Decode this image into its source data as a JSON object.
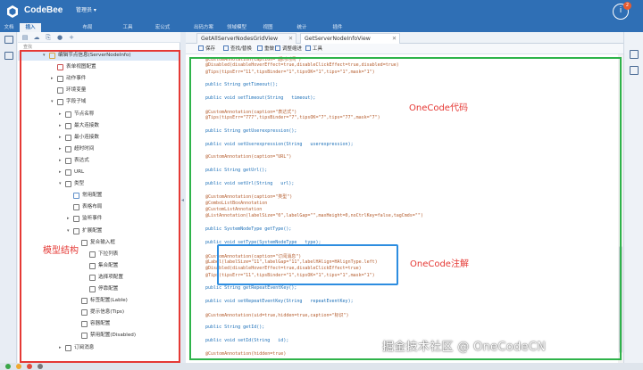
{
  "app": {
    "name": "CodeBee",
    "mode": "管理员 ▾",
    "notifications": "2"
  },
  "menu": [
    "文档",
    "插入",
    "布局",
    "工具",
    "宏公式",
    "出码方案",
    "领域模型",
    "视图",
    "统计",
    "插件"
  ],
  "menu_active": "插入",
  "tree_toolbar": [
    "▤",
    "☁",
    "⎘",
    "●",
    "+"
  ],
  "tree_header": "查找",
  "tree": [
    {
      "label": "编辑节点信息(ServerNodeInfo)",
      "depth": 0,
      "toggle": "▾",
      "color": "#d9a441"
    },
    {
      "label": "表单视图配置",
      "depth": 1,
      "toggle": "",
      "color": "#c94d4d"
    },
    {
      "label": "动作事件",
      "depth": 1,
      "toggle": "▸",
      "color": "#777"
    },
    {
      "label": "环境变量",
      "depth": 1,
      "toggle": "",
      "color": "#777"
    },
    {
      "label": "字段子域",
      "depth": 1,
      "toggle": "▾",
      "color": "#777"
    },
    {
      "label": "节点名称",
      "depth": 2,
      "toggle": "▸",
      "color": "#777"
    },
    {
      "label": "最大连接数",
      "depth": 2,
      "toggle": "▸",
      "color": "#777"
    },
    {
      "label": "最小连接数",
      "depth": 2,
      "toggle": "▸",
      "color": "#777"
    },
    {
      "label": "超时时间",
      "depth": 2,
      "toggle": "▸",
      "color": "#777"
    },
    {
      "label": "表达式",
      "depth": 2,
      "toggle": "▸",
      "color": "#777"
    },
    {
      "label": "URL",
      "depth": 2,
      "toggle": "▸",
      "color": "#777"
    },
    {
      "label": "类型",
      "depth": 2,
      "toggle": "▾",
      "color": "#777"
    },
    {
      "label": "常用配置",
      "depth": 3,
      "toggle": "",
      "color": "#5f8fc9"
    },
    {
      "label": "表格布局",
      "depth": 3,
      "toggle": "",
      "color": "#777"
    },
    {
      "label": "监听事件",
      "depth": 3,
      "toggle": "▸",
      "color": "#777"
    },
    {
      "label": "扩展配置",
      "depth": 3,
      "toggle": "▾",
      "color": "#777"
    },
    {
      "label": "复合输入框",
      "depth": 4,
      "toggle": "",
      "color": "#777"
    },
    {
      "label": "下拉列表",
      "depth": 5,
      "toggle": "",
      "color": "#777"
    },
    {
      "label": "集合配置",
      "depth": 5,
      "toggle": "",
      "color": "#777"
    },
    {
      "label": "选择项配置",
      "depth": 5,
      "toggle": "",
      "color": "#777"
    },
    {
      "label": "停靠配置",
      "depth": 5,
      "toggle": "",
      "color": "#777"
    },
    {
      "label": "标签配置(Lable)",
      "depth": 4,
      "toggle": "",
      "color": "#777"
    },
    {
      "label": "提示信息(Tips)",
      "depth": 4,
      "toggle": "",
      "color": "#777"
    },
    {
      "label": "容器配置",
      "depth": 4,
      "toggle": "",
      "color": "#777"
    },
    {
      "label": "禁用配置(Disabled)",
      "depth": 4,
      "toggle": "",
      "color": "#777"
    },
    {
      "label": "订阅消息",
      "depth": 2,
      "toggle": "▸",
      "color": "#777"
    }
  ],
  "tabs": [
    {
      "label": "GetAllServerNodesGridView",
      "active": false
    },
    {
      "label": "GetServerNodeInfoView",
      "active": true
    }
  ],
  "edit_toolbar": [
    "保存",
    "查找/替换",
    "重做",
    "调整缩进",
    "工具"
  ],
  "code_lines": [
    "  @CustomAnnotation(caption=\"超时时间\")",
    "  @Disabled(disableHoverEffect=true,disableClickEffect=true,disabled=true)",
    "  @Tips(tipsErr=\"11\",tipsBinder=\"1\",tipsOK=\"1\",tips=\"1\",mask=\"1\")",
    "",
    "  public String getTimeout();",
    "",
    "  public void setTimeout(String   timeout);",
    "",
    "  @CustomAnnotation(caption=\"表达式\")",
    "  @Tips(tipsErr=\"777\",tipsBinder=\"7\",tipsOK=\"7\",tips=\"77\",mask=\"7\")",
    "",
    "  public String getUserexpression();",
    "",
    "  public void setUserexpression(String   userexpression);",
    "",
    "  @CustomAnnotation(caption=\"URL\")",
    "",
    "  public String getUrl();",
    "",
    "  public void setUrl(String   url);",
    "",
    "  @CustomAnnotation(caption=\"类型\")",
    "  @ComboListBoxAnnotation",
    "  @CustomListAnnotation",
    "  @ListAnnotation(labelSize=\"0\",labelGap=\"\",maxHeight=0,noCtrlKey=false,tagCmds=\"\")",
    "",
    "  public SystemNodeType getType();",
    "",
    "  public void setType(SystemNodeType   type);",
    "",
    "  @CustomAnnotation(caption=\"订阅消息\")",
    "  @Label(labelSize=\"11\",labelGap=\"11\",labelHAlign=HAlignType.left)",
    "  @Disabled(disableHoverEffect=true,disableClickEffect=true)",
    "  @Tips(tipsErr=\"11\",tipsBinder=\"1\",tipsOK=\"1\",tips=\"1\",mask=\"1\")",
    "",
    "  public String getRepeatEventKey();",
    "",
    "  public void setRepeatEventKey(String   repeatEventKey);",
    "",
    "  @CustomAnnotation(uid=true,hidden=true,caption=\"标识\")",
    "",
    "  public String getId();",
    "",
    "  public void setId(String   id);",
    "",
    "  @CustomAnnotation(hidden=true)"
  ],
  "annotations": {
    "model_structure": "模型结构",
    "onecode_code": "OneCode代码",
    "onecode_annotation": "OneCode注解"
  },
  "watermark": "掘金技术社区 @ OneCodeCN",
  "colors": {
    "topbar": "#2f6fb5",
    "red_box": "#e53935",
    "green_box": "#2eb34a",
    "blue_box": "#2d8de0"
  }
}
